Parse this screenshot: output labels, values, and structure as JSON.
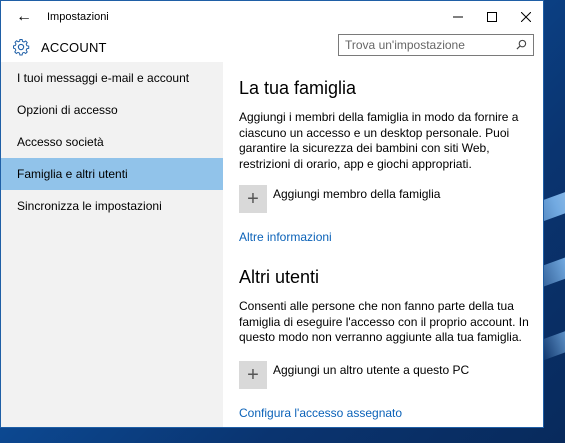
{
  "window": {
    "title": "Impostazioni"
  },
  "header": {
    "section_title": "ACCOUNT"
  },
  "search": {
    "placeholder": "Trova un'impostazione"
  },
  "sidebar": {
    "items": [
      {
        "label": "I tuoi messaggi e-mail e account"
      },
      {
        "label": "Opzioni di accesso"
      },
      {
        "label": "Accesso società"
      },
      {
        "label": "Famiglia e altri utenti",
        "selected": true
      },
      {
        "label": "Sincronizza le impostazioni"
      }
    ]
  },
  "family": {
    "heading": "La tua famiglia",
    "description": "Aggiungi i membri della famiglia in modo da fornire a ciascuno un accesso e un desktop personale. Puoi garantire la sicurezza dei bambini con siti Web, restrizioni di orario, app e giochi appropriati.",
    "add_label": "Aggiungi membro della famiglia",
    "link": "Altre informazioni"
  },
  "others": {
    "heading": "Altri utenti",
    "description": "Consenti alle persone che non fanno parte della tua famiglia di eseguire l'accesso con il proprio account. In questo modo non verranno aggiunte alla tua famiglia.",
    "add_label": "Aggiungi un altro utente a questo PC",
    "link": "Configura l'accesso assegnato"
  },
  "icons": {
    "back": "back-arrow-icon",
    "gear": "gear-icon",
    "search": "search-icon",
    "minimize": "minimize-icon",
    "maximize": "maximize-icon",
    "close": "close-icon",
    "plus": "plus-icon"
  },
  "colors": {
    "selected_item": "#91c3ea",
    "link": "#0b62b8",
    "sidebar_bg": "#f2f2f2",
    "plus_tile": "#d9d9d9"
  }
}
